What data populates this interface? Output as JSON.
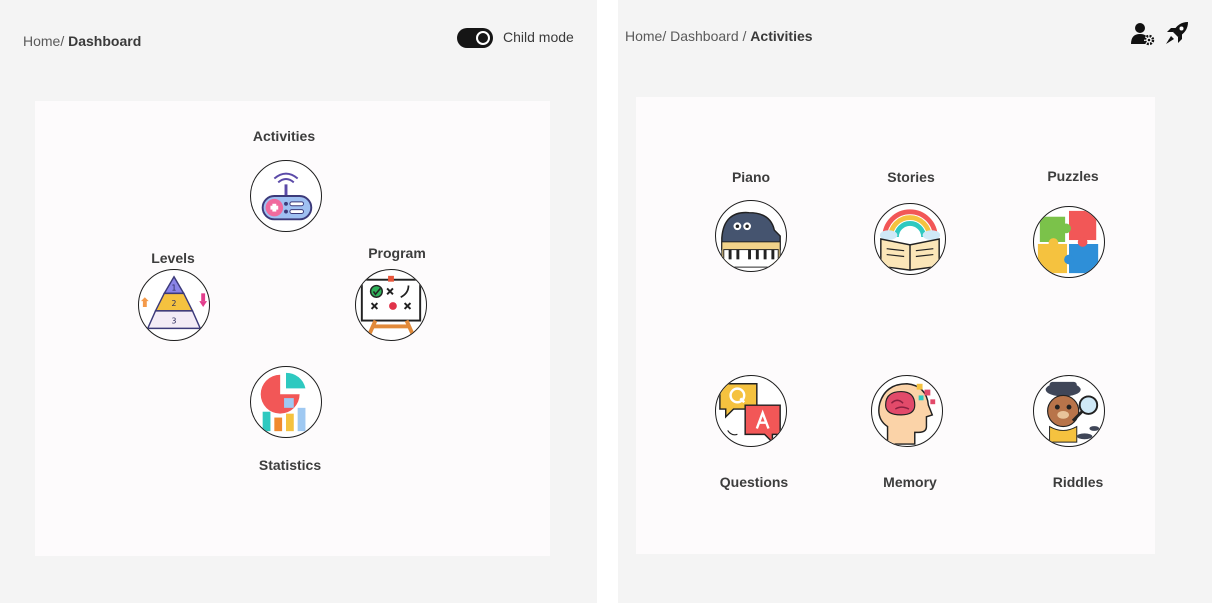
{
  "left": {
    "breadcrumb": {
      "home": "Home/",
      "current": "Dashboard"
    },
    "toggle": {
      "label": "Child mode",
      "on": true
    },
    "menu": {
      "activities": "Activities",
      "levels": "Levels",
      "program": "Program",
      "statistics": "Statistics"
    }
  },
  "right": {
    "breadcrumb": {
      "home": "Home/",
      "parent": "Dashboard",
      "sep": "/",
      "current": "Activities"
    },
    "activities": {
      "piano": "Piano",
      "stories": "Stories",
      "puzzles": "Puzzles",
      "questions": "Questions",
      "memory": "Memory",
      "riddles": "Riddles"
    },
    "levels_icon_numbers": [
      "1",
      "2",
      "3"
    ]
  },
  "icons": {
    "header": [
      "user-settings-icon",
      "rocket-icon"
    ],
    "activities": "gamepad-icon",
    "levels": "pyramid-levels-icon",
    "program": "strategy-board-icon",
    "statistics": "statistics-chart-icon",
    "piano": "piano-icon",
    "stories": "storybook-icon",
    "puzzles": "puzzle-icon",
    "questions": "question-answer-icon",
    "memory": "brain-memory-icon",
    "riddles": "detective-riddle-icon"
  }
}
